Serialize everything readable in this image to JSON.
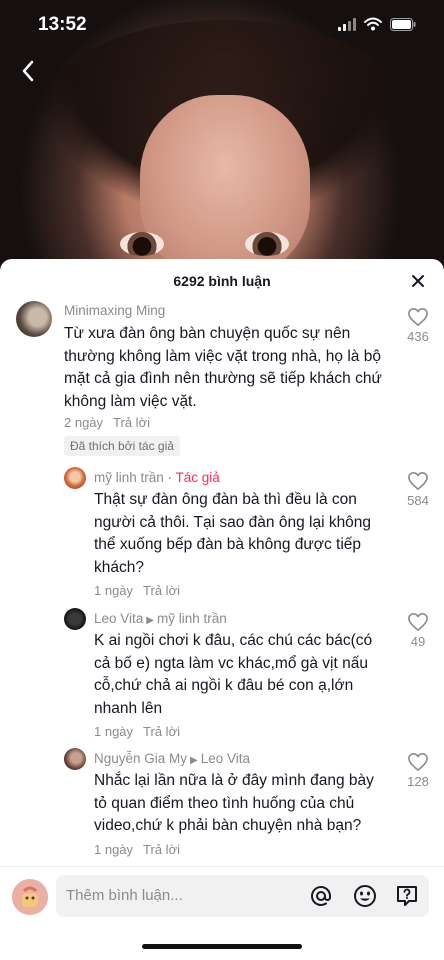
{
  "status_bar": {
    "time": "13:52"
  },
  "sheet": {
    "title": "6292 bình luận"
  },
  "comments": [
    {
      "author": "Minimaxing Ming",
      "text": "Từ xưa đàn ông bàn chuyện quốc sự nên thường không làm việc vặt trong nhà, họ là bộ mặt cả gia đình nên thường sẽ tiếp khách chứ không làm việc vặt.",
      "time": "2 ngày",
      "reply_label": "Trả lời",
      "badge": "Đã thích bởi tác giả",
      "likes": "436"
    },
    {
      "author": "mỹ linh trần",
      "author_tag": " · Tác giả",
      "text": "Thật sự đàn ông đàn bà thì đều là con người cả thôi. Tại sao đàn ông lại không thể xuống bếp đàn bà không được tiếp khách?",
      "time": "1 ngày",
      "reply_label": "Trả lời",
      "likes": "584"
    },
    {
      "author": "Leo Vita",
      "reply_to": "mỹ linh trần",
      "text": "K ai ngồi chơi k đâu, các chú các bác(có cả bố e) ngta làm vc khác,mổ gà vịt nấu cỗ,chứ chả ai ngồi k đâu bé con ạ,lớn nhanh lên",
      "time": "1 ngày",
      "reply_label": "Trả lời",
      "likes": "49"
    },
    {
      "author": "Nguyễn Gia My",
      "reply_to": "Leo Vita",
      "text": "Nhắc lại lần nữa là ở đây mình đang bày tỏ quan điểm theo tình huống của chủ video,chứ k phải bàn chuyện nhà bạn?",
      "time": "1 ngày",
      "reply_label": "Trả lời",
      "likes": "128"
    }
  ],
  "input": {
    "placeholder": "Thêm bình luận..."
  },
  "colors": {
    "author_tag": "#fe2c55",
    "muted": "#8a8b91",
    "text": "#161823"
  },
  "icons": [
    "back-icon",
    "close-icon",
    "heart-icon",
    "at-icon",
    "emoji-icon",
    "question-icon"
  ]
}
